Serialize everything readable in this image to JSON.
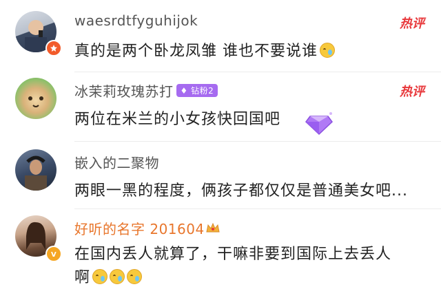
{
  "comments": [
    {
      "username": "waesrdtfyguhijok",
      "text": "真的是两个卧龙凤雏 谁也不要说谁",
      "hot": "热评",
      "emoji_count": 1
    },
    {
      "username": "冰茉莉玫瑰苏打",
      "badge": "钻粉2",
      "text": "两位在米兰的小女孩快回国吧",
      "hot": "热评"
    },
    {
      "username": "嵌入的二聚物",
      "text": "两眼一黑的程度，俩孩子都仅仅是普通美女吧..."
    },
    {
      "username": "好听的名字 201604",
      "text_line1": "在国内丢人就算了，干嘛非要到国际上去丢人",
      "text_line2": "啊"
    }
  ],
  "colors": {
    "hot": "#e8393c",
    "vip_name": "#e8762c",
    "badge": "#a66bf0"
  },
  "icons": [
    "laugh-cry-emoji-icon",
    "diamond-fan-badge-icon",
    "crown-icon",
    "verified-badge-icon"
  ]
}
